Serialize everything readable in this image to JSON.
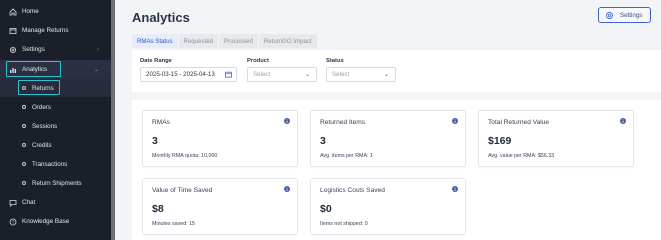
{
  "sidebar": {
    "items": [
      {
        "label": "Home",
        "icon": "home-icon"
      },
      {
        "label": "Manage Returns",
        "icon": "return-icon"
      },
      {
        "label": "Settings",
        "icon": "gear-icon"
      },
      {
        "label": "Analytics",
        "icon": "chart-icon"
      },
      {
        "label": "Chat",
        "icon": "chat-icon"
      },
      {
        "label": "Knowledge Base",
        "icon": "help-icon"
      }
    ],
    "analytics_sub": [
      {
        "label": "Returns"
      },
      {
        "label": "Orders"
      },
      {
        "label": "Sessions"
      },
      {
        "label": "Credits"
      },
      {
        "label": "Transactions"
      },
      {
        "label": "Return Shipments"
      }
    ]
  },
  "header": {
    "title": "Analytics",
    "settings_label": "Settings"
  },
  "tabs": [
    {
      "label": "RMAs Status"
    },
    {
      "label": "Requested"
    },
    {
      "label": "Processed"
    },
    {
      "label": "ReturnGO Impact"
    }
  ],
  "filters": {
    "date_range": {
      "label": "Date Range",
      "value": "2025-03-15 - 2025-04-13"
    },
    "product": {
      "label": "Product",
      "placeholder": "Select"
    },
    "status": {
      "label": "Status",
      "placeholder": "Select"
    }
  },
  "cards": [
    {
      "title": "RMAs",
      "value": "3",
      "sub": "Monthly RMA quota: 10,000"
    },
    {
      "title": "Returned Items",
      "value": "3",
      "sub": "Avg. items per RMA: 1"
    },
    {
      "title": "Total Returned Value",
      "value": "$169",
      "sub": "Avg. value per RMA: $56.33"
    },
    {
      "title": "Value of Time Saved",
      "value": "$8",
      "sub": "Minutes saved: 15"
    },
    {
      "title": "Logistics Costs Saved",
      "value": "$0",
      "sub": "Items not shipped: 0"
    }
  ],
  "colors": {
    "sidebar_bg": "#1b1f2a",
    "accent": "#2f56c8",
    "highlight": "#2fc1cf"
  }
}
